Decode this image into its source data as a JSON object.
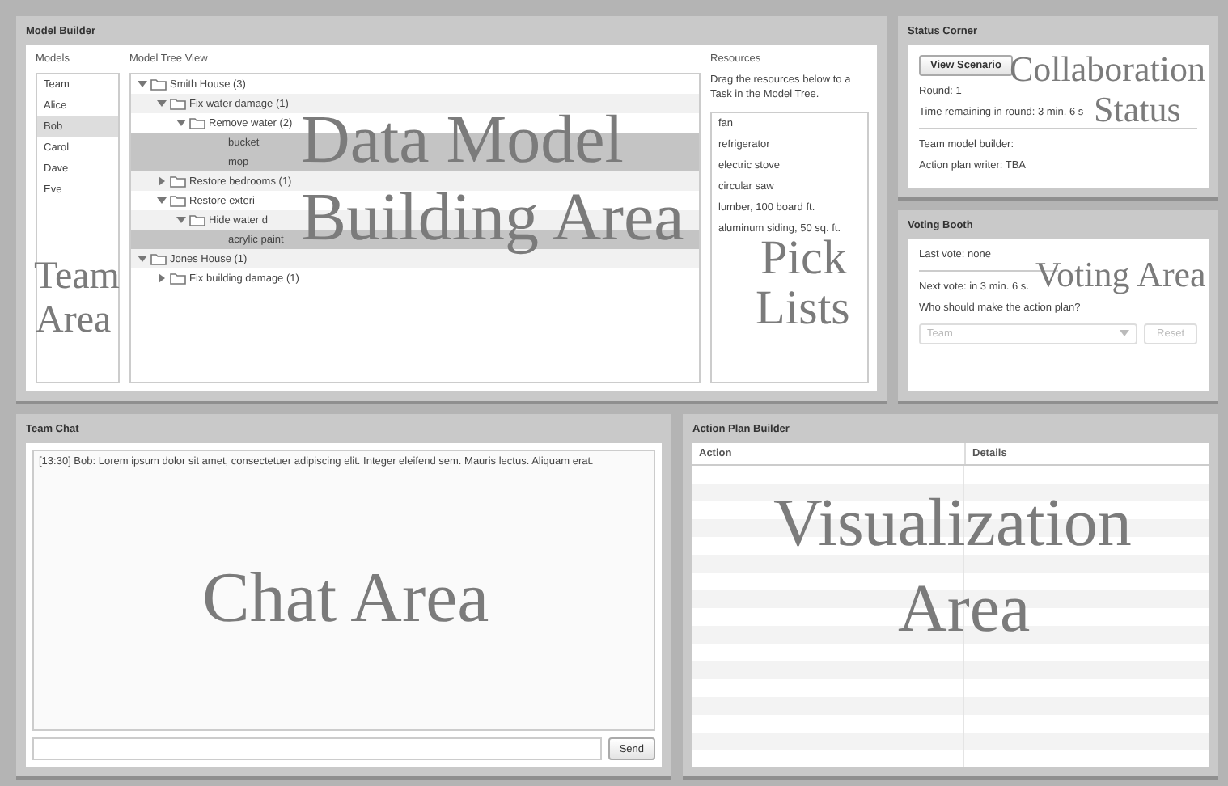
{
  "model_builder": {
    "title": "Model Builder",
    "models_label": "Models",
    "tree_label": "Model Tree View",
    "resources_label": "Resources",
    "resources_hint": "Drag the resources below to a Task in the Model Tree.",
    "models": [
      {
        "name": "Team",
        "selected": false
      },
      {
        "name": "Alice",
        "selected": false
      },
      {
        "name": "Bob",
        "selected": true
      },
      {
        "name": "Carol",
        "selected": false
      },
      {
        "name": "Dave",
        "selected": false
      },
      {
        "name": "Eve",
        "selected": false
      }
    ],
    "tree": [
      {
        "label": "Smith House (3)",
        "expanded": true,
        "selected": false,
        "children": [
          {
            "label": "Fix water damage (1)",
            "expanded": true,
            "selected": false,
            "children": [
              {
                "label": "Remove water (2)",
                "expanded": true,
                "selected": false,
                "children": [
                  {
                    "label": "bucket",
                    "selected": true
                  },
                  {
                    "label": "mop",
                    "selected": true
                  }
                ]
              }
            ]
          },
          {
            "label": "Restore bedrooms (1)",
            "expanded": false,
            "selected": false
          },
          {
            "label": "Restore exteri",
            "expanded": true,
            "selected": false,
            "children": [
              {
                "label": "Hide water d",
                "expanded": true,
                "selected": false,
                "children": [
                  {
                    "label": "acrylic paint",
                    "selected": true
                  }
                ]
              }
            ]
          }
        ]
      },
      {
        "label": "Jones House (1)",
        "expanded": true,
        "selected": false,
        "children": [
          {
            "label": "Fix building damage (1)",
            "expanded": false,
            "selected": false
          }
        ]
      }
    ],
    "resources": [
      "fan",
      "refrigerator",
      "electric stove",
      "circular saw",
      "lumber, 100 board ft.",
      "aluminum siding, 50 sq. ft."
    ]
  },
  "status_corner": {
    "title": "Status Corner",
    "button": "View Scenario",
    "lines": [
      "Round: 1",
      "Time remaining in round: 3 min. 6 s",
      "Team model builder:",
      "Action plan writer: TBA"
    ]
  },
  "voting_booth": {
    "title": "Voting Booth",
    "last_vote": "Last vote: none",
    "next_vote": "Next vote: in 3 min. 6 s.",
    "question": "Who should make the action plan?",
    "choice": "Team",
    "choice_disabled": true,
    "reset": "Reset",
    "reset_disabled": true
  },
  "team_chat": {
    "title": "Team Chat",
    "messages": [
      "[13:30] Bob: Lorem ipsum dolor sit amet, consectetuer adipiscing elit. Integer eleifend sem. Mauris lectus. Aliquam erat."
    ],
    "send": "Send"
  },
  "action_plan": {
    "title": "Action Plan Builder",
    "columns": [
      "Action",
      "Details"
    ]
  },
  "annotations": [
    {
      "lines": [
        "Team",
        "Area"
      ]
    },
    {
      "lines": [
        "Data Model",
        "Building Area"
      ]
    },
    {
      "lines": [
        "Pick",
        "Lists"
      ]
    },
    {
      "lines": [
        "Collaboration",
        "Status"
      ]
    },
    {
      "lines": [
        "Voting Area"
      ]
    },
    {
      "lines": [
        "Chat Area"
      ]
    },
    {
      "lines": [
        "Visualization",
        "Area"
      ]
    }
  ]
}
